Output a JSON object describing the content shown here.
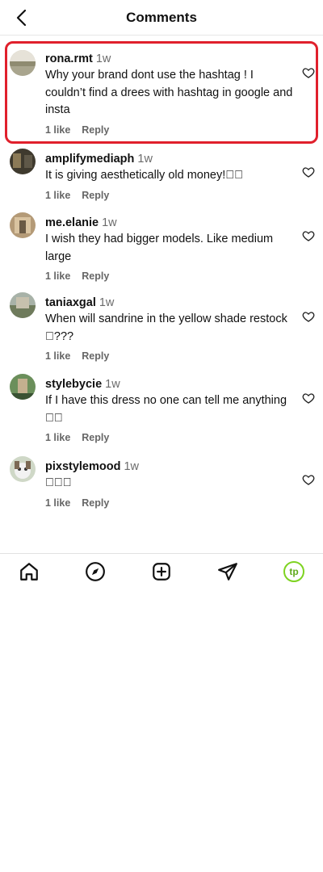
{
  "header": {
    "title": "Comments"
  },
  "comments": [
    {
      "username": "rona.rmt",
      "time": "1w",
      "text": "Why your brand dont use the hashtag ! I couldn’t find a drees with hashtag in google and insta",
      "likes": "1 like",
      "reply": "Reply"
    },
    {
      "username": "amplifymediaph",
      "time": "1w",
      "text": "It is giving aesthetically old money!\u0000\u0000",
      "likes": "1 like",
      "reply": "Reply"
    },
    {
      "username": "me.elanie",
      "time": "1w",
      "text": "I wish they had bigger models. Like medium large",
      "likes": "1 like",
      "reply": "Reply"
    },
    {
      "username": "taniaxgal",
      "time": "1w",
      "text": "When will sandrine in the yellow shade restock \u0000???",
      "likes": "1 like",
      "reply": "Reply"
    },
    {
      "username": "stylebycie",
      "time": "1w",
      "text": "If I have this dress no one can tell me anything \u0000\u0000",
      "likes": "1 like",
      "reply": "Reply"
    },
    {
      "username": "pixstylemood",
      "time": "1w",
      "text": "\u0000\u0000\u0000",
      "likes": "1 like",
      "reply": "Reply"
    }
  ],
  "tabbar": {
    "profile_badge": "tp"
  },
  "colors": {
    "highlight": "#e0202c",
    "badge": "#7ed321"
  },
  "icons": [
    "back-chevron-icon",
    "heart-icon",
    "home-icon",
    "explore-icon",
    "create-icon",
    "send-icon"
  ]
}
